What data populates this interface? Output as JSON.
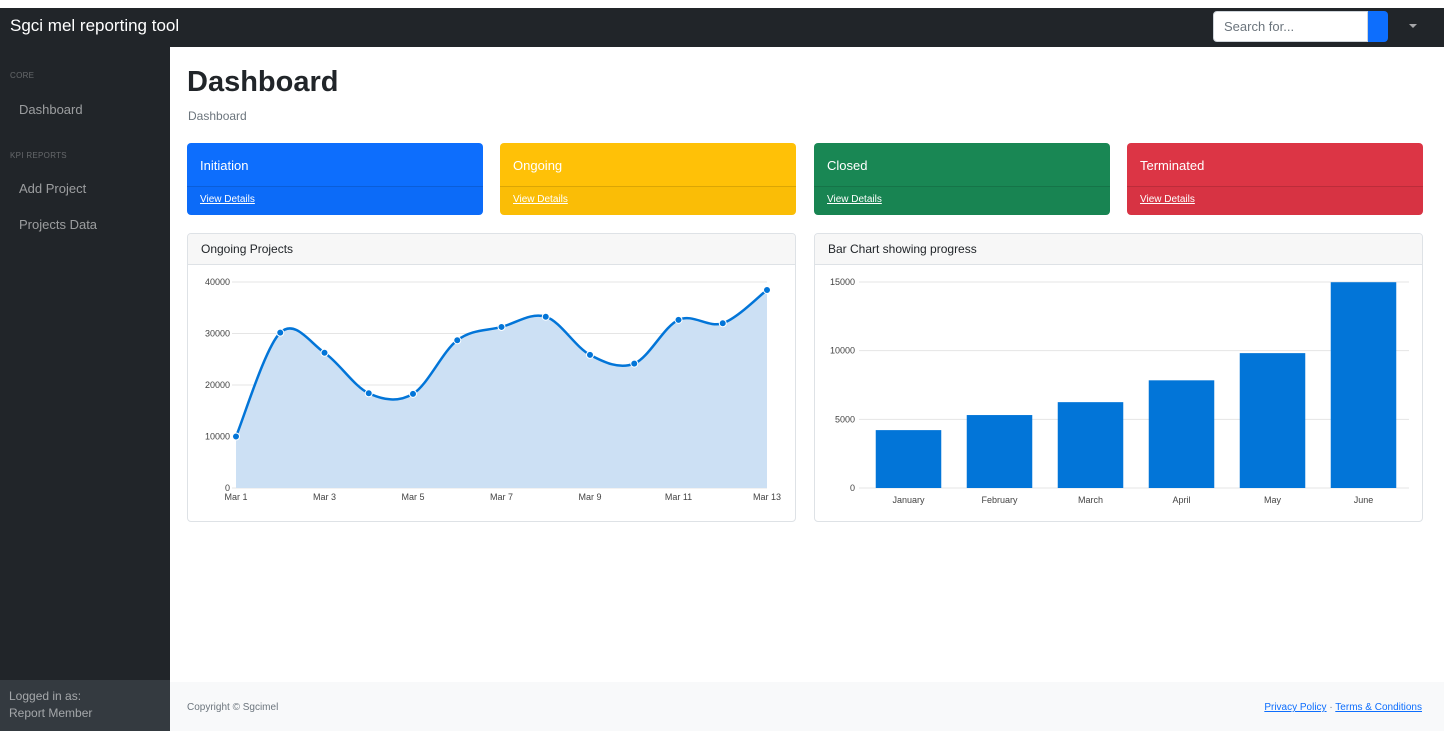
{
  "app": {
    "title": "Sgci mel reporting tool"
  },
  "search": {
    "placeholder": "Search for..."
  },
  "sidebar": {
    "sections": [
      {
        "heading": "CORE",
        "items": [
          {
            "label": "Dashboard"
          }
        ]
      },
      {
        "heading": "KPI REPORTS",
        "items": [
          {
            "label": "Add Project"
          },
          {
            "label": "Projects Data"
          }
        ]
      }
    ],
    "footer": {
      "logged_in_label": "Logged in as:",
      "user": "Report Member"
    }
  },
  "main": {
    "title": "Dashboard",
    "breadcrumb": "Dashboard",
    "cards": [
      {
        "label": "Initiation",
        "link": "View Details",
        "color": "#0d6efd"
      },
      {
        "label": "Ongoing",
        "link": "View Details",
        "color": "#ffc107"
      },
      {
        "label": "Closed",
        "link": "View Details",
        "color": "#198754"
      },
      {
        "label": "Terminated",
        "link": "View Details",
        "color": "#dc3545"
      }
    ]
  },
  "charts": {
    "area_title": "Ongoing Projects",
    "bar_title": "Bar Chart showing progress"
  },
  "chart_data": [
    {
      "type": "area",
      "title": "Ongoing Projects",
      "x": [
        "Mar 1",
        "Mar 2",
        "Mar 3",
        "Mar 4",
        "Mar 5",
        "Mar 6",
        "Mar 7",
        "Mar 8",
        "Mar 9",
        "Mar 10",
        "Mar 11",
        "Mar 12",
        "Mar 13"
      ],
      "x_tick_labels": [
        "Mar 1",
        "Mar 3",
        "Mar 5",
        "Mar 7",
        "Mar 9",
        "Mar 11",
        "Mar 13"
      ],
      "values": [
        10000,
        30162,
        26263,
        18394,
        18287,
        28682,
        31274,
        33259,
        25849,
        24159,
        32651,
        31984,
        38451
      ],
      "ylim": [
        0,
        40000
      ],
      "y_ticks": [
        0,
        10000,
        20000,
        30000,
        40000
      ],
      "grid": true,
      "line_color": "#0275d8",
      "fill_color": "#cce0f4"
    },
    {
      "type": "bar",
      "title": "Bar Chart showing progress",
      "categories": [
        "January",
        "February",
        "March",
        "April",
        "May",
        "June"
      ],
      "values": [
        4215,
        5312,
        6251,
        7841,
        9821,
        14984
      ],
      "ylim": [
        0,
        15000
      ],
      "y_ticks": [
        0,
        5000,
        10000,
        15000
      ],
      "grid": true,
      "bar_color": "#0275d8"
    }
  ],
  "footer": {
    "copyright": "Copyright © Sgcimel",
    "privacy": "Privacy Policy",
    "separator": "·",
    "terms": "Terms & Conditions"
  }
}
